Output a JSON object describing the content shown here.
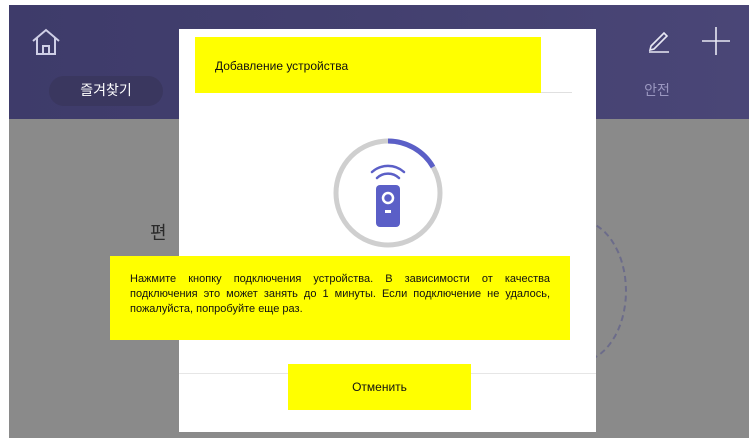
{
  "header": {
    "home_icon": "home-icon",
    "edit_icon": "pencil-icon",
    "add_icon": "plus-icon",
    "tabs": [
      {
        "label": "즐겨찾기"
      },
      {
        "label": "안전"
      }
    ]
  },
  "background": {
    "partial_label": "편"
  },
  "dialog": {
    "title": "Добавление  устройства",
    "message": "Нажмите кнопку подключения устройства. В зависимости от качества подключения это может занять до 1 минуты. Если подключение не удалось, пожалуйста, попробуйте еще раз.",
    "cancel_label": "Отменить",
    "device_icon": "remote-device-icon",
    "spinner_icon": "loading-spinner-icon"
  },
  "colors": {
    "header": "#423f6f",
    "overlay": "#8a8a8a",
    "accent": "#5b5fc7",
    "highlight": "#ffff00"
  }
}
